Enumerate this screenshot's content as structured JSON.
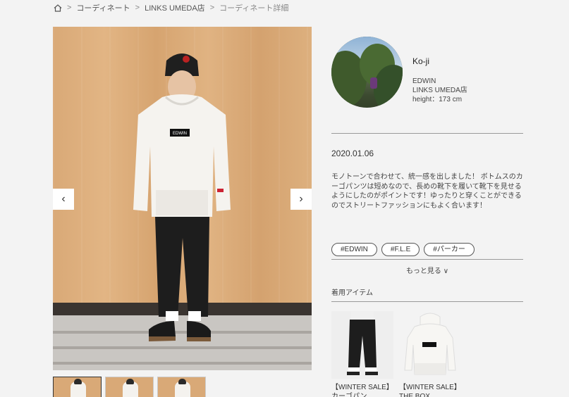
{
  "breadcrumb": {
    "home_icon": "home-icon",
    "items": [
      "コーディネート",
      "LINKS UMEDA店",
      "コーディネート詳細"
    ]
  },
  "gallery": {
    "prev_arrow": "‹",
    "next_arrow": "›",
    "thumbnail_count": 3,
    "main_photo_badge": "EDWIN"
  },
  "profile": {
    "name": "Ko-ji",
    "brand": "EDWIN",
    "store": "LINKS UMEDA店",
    "height": "height：173 cm"
  },
  "post": {
    "date": "2020.01.06",
    "description": "モノトーンで合わせて、統一感を出しました！ ボトムスのカーゴパンツは短めなので、長めの靴下を履いて靴下を見せるようにしたのがポイントです！ゆったりと穿くことができるのでストリートファッションにもよく合います！"
  },
  "tags": [
    "#EDWIN",
    "#F.L.E",
    "#パーカー"
  ],
  "more_label": "もっと見る ∨",
  "items_heading": "着用アイテム",
  "items": [
    {
      "label": "【WINTER SALE】カーゴパン"
    },
    {
      "label": "【WINTER SALE】THE BOX"
    }
  ]
}
